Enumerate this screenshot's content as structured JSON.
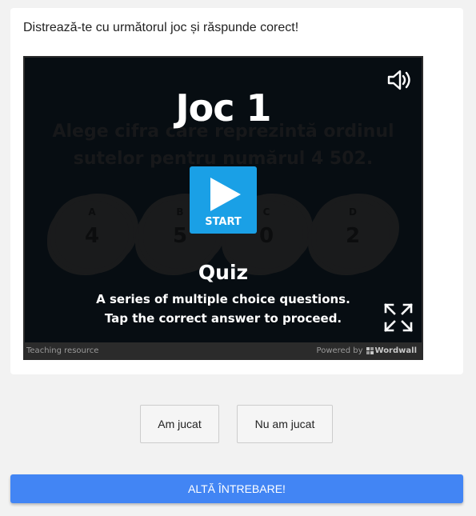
{
  "intro_text": "Distrează-te cu următorul joc și răspunde corect!",
  "game": {
    "title": "Joc 1",
    "background_question_line1": "Alege cifra care reprezintă ordinul",
    "background_question_line2": "sutelor pentru numărul 4 502.",
    "options": [
      {
        "letter": "A",
        "value": "4"
      },
      {
        "letter": "B",
        "value": "5"
      },
      {
        "letter": "C",
        "value": "0"
      },
      {
        "letter": "D",
        "value": "2"
      }
    ],
    "start_label": "START",
    "template_name": "Quiz",
    "description_line1": "A series of multiple choice questions.",
    "description_line2": "Tap the correct answer to proceed.",
    "footer_left": "Teaching resource",
    "footer_powered": "Powered by",
    "footer_brand": "Wordwall",
    "icons": {
      "sound": "speaker-volume-icon",
      "fullscreen": "fullscreen-expand-icon",
      "start": "play-icon"
    }
  },
  "buttons": {
    "played": "Am jucat",
    "not_played": "Nu am jucat",
    "next_question": "ALTĂ ÎNTREBARE!"
  },
  "colors": {
    "start_button": "#1aa0e6",
    "next_button": "#4285f4",
    "game_background": "#070d12",
    "page_background": "#f2f2f2"
  }
}
